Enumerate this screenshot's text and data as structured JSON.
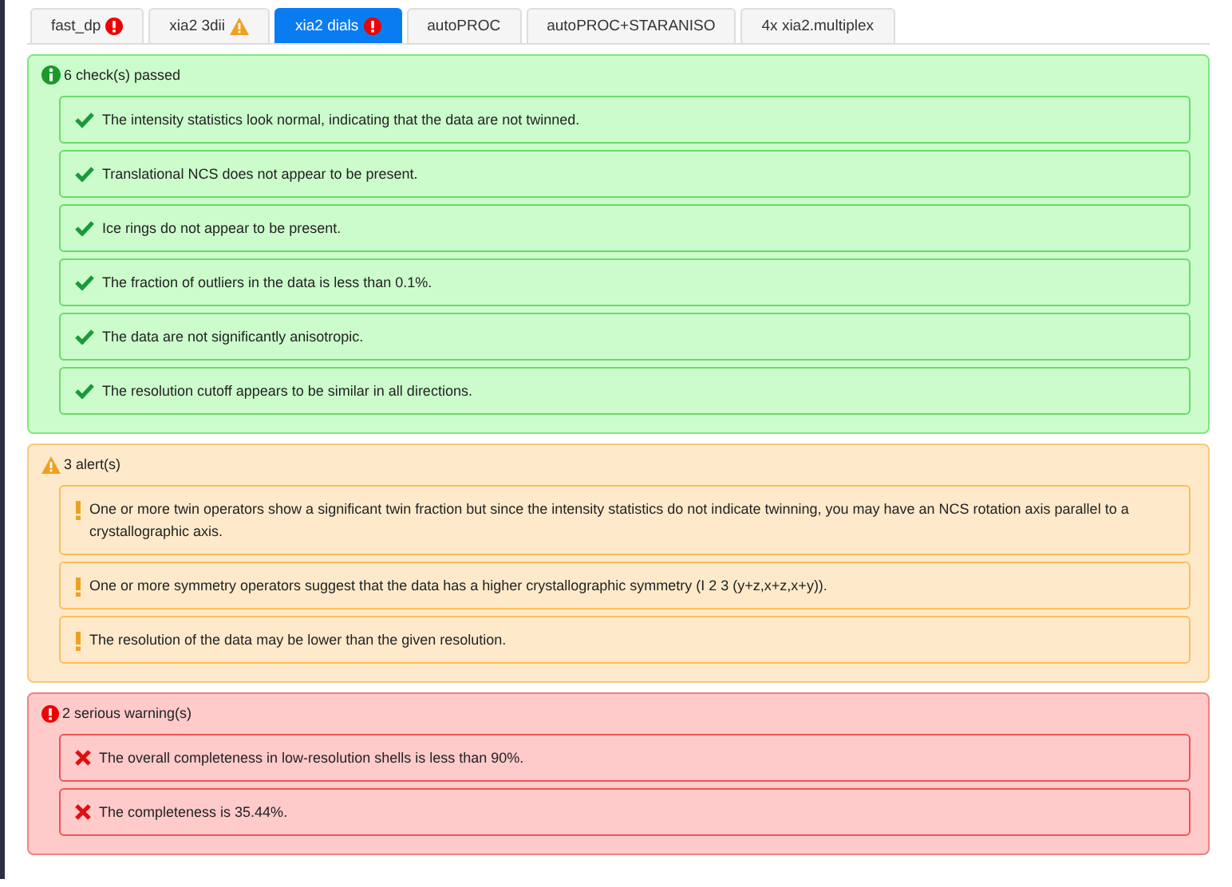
{
  "tabs": [
    {
      "label": "fast_dp",
      "kind": "error",
      "selected": false
    },
    {
      "label": "xia2 3dii",
      "kind": "warning",
      "selected": false
    },
    {
      "label": "xia2 dials",
      "kind": "error",
      "selected": true
    },
    {
      "label": "autoPROC",
      "kind": "plain",
      "selected": false
    },
    {
      "label": "autoPROC+STARANISO",
      "kind": "plain",
      "selected": false
    },
    {
      "label": "4x xia2.multiplex",
      "kind": "plain",
      "selected": false
    }
  ],
  "sections": [
    {
      "kind": "passed",
      "title": "6 check(s) passed",
      "items": [
        "The intensity statistics look normal, indicating that the data are not twinned.",
        "Translational NCS does not appear to be present.",
        "Ice rings do not appear to be present.",
        "The fraction of outliers in the data is less than 0.1%.",
        "The data are not significantly anisotropic.",
        "The resolution cutoff appears to be similar in all directions."
      ]
    },
    {
      "kind": "alert",
      "title": "3 alert(s)",
      "items": [
        "One or more twin operators show a significant twin fraction but since the intensity statistics do not indicate twinning, you may have an NCS rotation axis parallel to a crystallographic axis.",
        "One or more symmetry operators suggest that the data has a higher crystallographic symmetry (I 2 3 (y+z,x+z,x+y)).",
        "The resolution of the data may be lower than the given resolution."
      ]
    },
    {
      "kind": "serious",
      "title": "2 serious warning(s)",
      "items": [
        "The overall completeness in low-resolution shells is less than 90%.",
        "The completeness is 35.44%."
      ]
    }
  ]
}
